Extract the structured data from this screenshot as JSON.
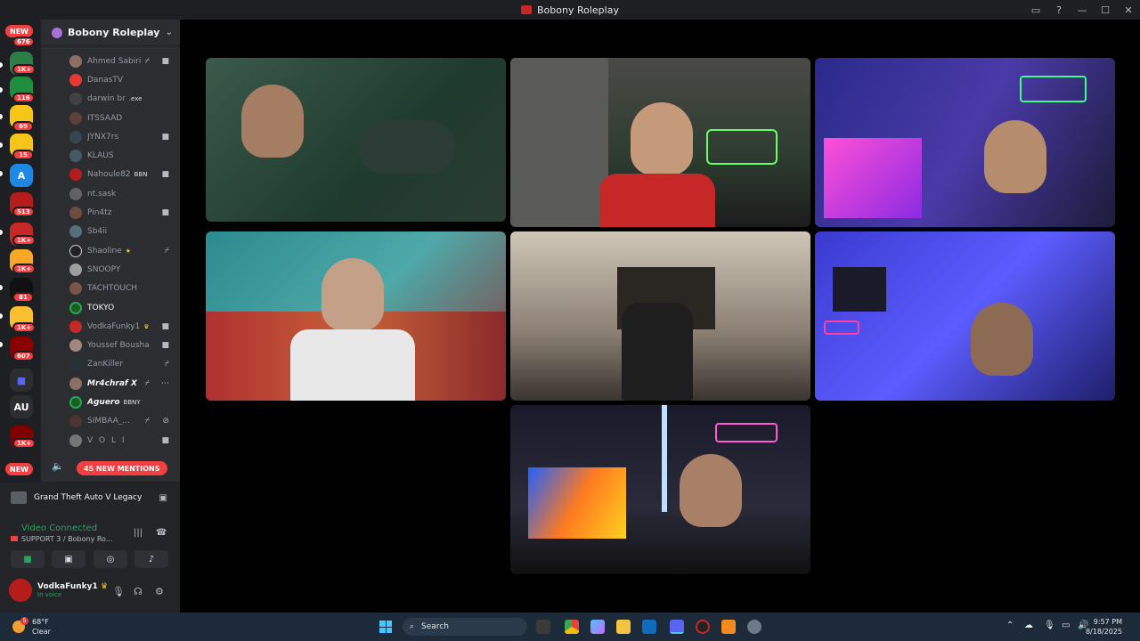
{
  "window": {
    "title": "Bobony Roleplay"
  },
  "rail": {
    "new_top": "NEW",
    "new_bottom": "NEW",
    "badges": [
      "676",
      "1K+",
      "116",
      "69",
      "15",
      "513",
      "1K+",
      "1K+",
      "81",
      "1K+",
      "607",
      "1K+"
    ],
    "au_label": "AU"
  },
  "server": {
    "name": "Bobony Roleplay"
  },
  "members": [
    {
      "name": "Ahmed Sabiri",
      "icon": "video-icon"
    },
    {
      "name": "DanasTV"
    },
    {
      "name": "darwin br",
      "tag": ".exe"
    },
    {
      "name": "ITSSAAD"
    },
    {
      "name": "JYNX7rs",
      "icon": "video-icon"
    },
    {
      "name": "KLAUS"
    },
    {
      "name": "Nahoule82",
      "tag": "BBN",
      "icon": "video-icon"
    },
    {
      "name": "nt.sask"
    },
    {
      "name": "Pin4tz",
      "icon": "video-icon"
    },
    {
      "name": "Sb4ii"
    },
    {
      "name": "Shaoline",
      "icon": "muted-icon"
    },
    {
      "name": "SNOOPY"
    },
    {
      "name": "TACHTOUCH"
    },
    {
      "name": "TOKYO"
    },
    {
      "name": "VodkaFunky1",
      "icon": "video-icon"
    },
    {
      "name": "Youssef Boushaq",
      "icon": "video-icon"
    },
    {
      "name": "ZanKiller",
      "icon": "muted-icon"
    },
    {
      "name": "Mr4chraf X"
    },
    {
      "name": "Aguero",
      "tag": "BBNY"
    },
    {
      "name": "SIMBAA_..."
    },
    {
      "name": "V O L I",
      "icon": "video-icon"
    }
  ],
  "mentions_label": "45 NEW MENTIONS",
  "voice": {
    "activity": "Grand Theft Auto V Legacy",
    "status": "Video Connected",
    "channel": "SUPPORT 3 / Bobony Ro..."
  },
  "user": {
    "name": "VodkaFunky1",
    "status": "In voice"
  },
  "taskbar": {
    "weather_temp": "68°F",
    "weather_desc": "Clear",
    "weather_badge": "5",
    "search_placeholder": "Search",
    "time": "9:57 PM",
    "date": "8/18/2025"
  },
  "colors": {
    "discord_dark": "#1e1f22",
    "sidebar": "#2b2d31",
    "accent_red": "#f23f42",
    "voice_green": "#23a55a",
    "taskbar": "#1c2a3a"
  }
}
